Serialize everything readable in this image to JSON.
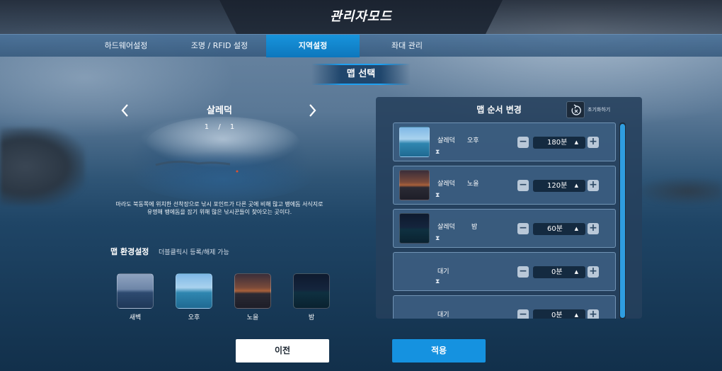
{
  "header": {
    "title": "관리자모드"
  },
  "tabs": [
    {
      "label": "하드웨어설정",
      "active": false
    },
    {
      "label": "조명 / RFID 설정",
      "active": false
    },
    {
      "label": "지역설정",
      "active": true
    },
    {
      "label": "좌대 관리",
      "active": false
    }
  ],
  "section": {
    "title": "맵 선택"
  },
  "map_selector": {
    "name": "살레덕",
    "page_current": "1",
    "page_separator": "/",
    "page_total": "1",
    "description_line1": "마라도 북동쪽에 위치한 선착장으로 낚시 포인트가 다른 곳에 비해 많고 뱅에돔 서식지로",
    "description_line2": "유명해 뱅에돔을 잡기 위해 많은 낚시꾼들이 찾아오는 곳이다."
  },
  "environment": {
    "title": "맵 환경설정",
    "hint": "더블클릭시 등록/해제 가능",
    "items": [
      {
        "label": "새벽"
      },
      {
        "label": "오후"
      },
      {
        "label": "노을"
      },
      {
        "label": "밤"
      }
    ]
  },
  "order_panel": {
    "title": "맵 순서 변경",
    "reset_label": "초기화하기",
    "rows": [
      {
        "name": "살레덕",
        "time": "오후",
        "duration": "180분"
      },
      {
        "name": "살레덕",
        "time": "노을",
        "duration": "120분"
      },
      {
        "name": "살레덕",
        "time": "밤",
        "duration": "60분"
      },
      {
        "name": "대기",
        "time": "",
        "duration": "0분"
      },
      {
        "name": "대기",
        "time": "",
        "duration": "0분"
      }
    ]
  },
  "footer": {
    "prev_label": "이전",
    "apply_label": "적용"
  },
  "colors": {
    "accent": "#1592e0",
    "active_tab": "#1894dc"
  }
}
